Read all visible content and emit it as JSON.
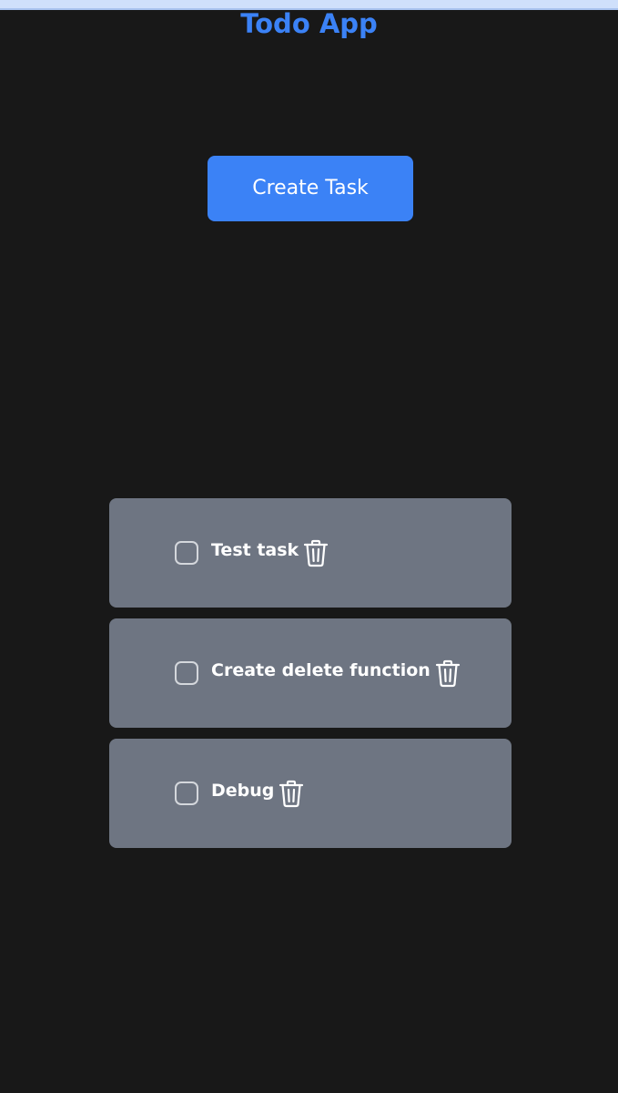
{
  "app": {
    "title": "Todo App"
  },
  "toolbar": {
    "create_label": "Create Task"
  },
  "colors": {
    "background": "#181818",
    "accent": "#3b82f6",
    "card": "#6e7582",
    "text": "#ffffff"
  },
  "tasks": [
    {
      "label": "Test task",
      "checked": false,
      "delete_icon": "trash-icon"
    },
    {
      "label": "Create delete function",
      "checked": false,
      "delete_icon": "trash-icon"
    },
    {
      "label": "Debug",
      "checked": false,
      "delete_icon": "trash-icon"
    }
  ]
}
